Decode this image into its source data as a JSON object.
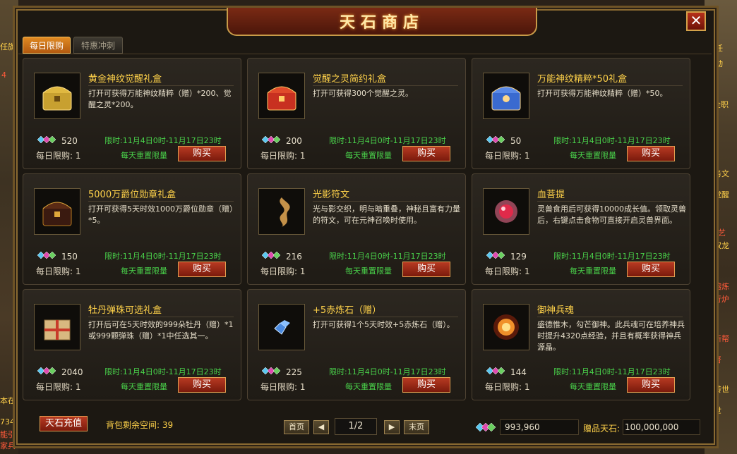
{
  "shop": {
    "title": "天石商店",
    "close_label": "✕",
    "tabs": [
      "每日限购",
      "特惠冲刺"
    ],
    "items": [
      {
        "name": "黄金神纹觉醒礼盒",
        "desc": "打开可获得万能神纹精粹（赠）*200、觉醒之灵*200。",
        "price": "520",
        "time": "限时:11月4日0时-11月17日23时",
        "daily": "每日限购: 1",
        "reset": "每天重置限量",
        "buy": "购买",
        "icon": "golden-chest-icon",
        "color": "#c8a030"
      },
      {
        "name": "觉醒之灵简约礼盒",
        "desc": "打开可获得300个觉醒之灵。",
        "price": "200",
        "time": "限时:11月4日0时-11月17日23时",
        "daily": "每日限购: 1",
        "reset": "每天重置限量",
        "buy": "购买",
        "icon": "red-chest-icon",
        "color": "#c83020"
      },
      {
        "name": "万能神纹精粹*50礼盒",
        "desc": "打开可获得万能神纹精粹（赠）*50。",
        "price": "50",
        "time": "限时:11月4日0时-11月17日23时",
        "daily": "每日限购: 1",
        "reset": "每天重置限量",
        "buy": "购买",
        "icon": "blue-chest-icon",
        "color": "#3a6ad0"
      },
      {
        "name": "5000万爵位勋章礼盒",
        "desc": "打开可获得5天时效1000万爵位勋章（赠）*5。",
        "price": "150",
        "time": "限时:11月4日0时-11月17日23时",
        "daily": "每日限购: 1",
        "reset": "每天重置限量",
        "buy": "购买",
        "icon": "medal-chest-icon",
        "color": "#b87a20"
      },
      {
        "name": "光影符文",
        "desc": "光与影交织，明与暗重叠，神秘且富有力量的符文，可在元神召唤时使用。",
        "price": "216",
        "time": "限时:11月4日0时-11月17日23时",
        "daily": "每日限购: 1",
        "reset": "每天重置限量",
        "buy": "购买",
        "icon": "rune-icon",
        "color": "#d8a050"
      },
      {
        "name": "血菩提",
        "desc": "灵兽食用后可获得10000成长值。领取灵兽后，右键点击食物可直接开启灵兽界面。",
        "price": "129",
        "time": "限时:11月4日0时-11月17日23时",
        "daily": "每日限购: 1",
        "reset": "每天重置限量",
        "buy": "购买",
        "icon": "blood-bodhi-icon",
        "color": "#e02a4a"
      },
      {
        "name": "牡丹弹珠可选礼盒",
        "desc": "打开后可在5天时效的999朵牡丹（赠）*1或999颗弹珠（赠）*1中任选其一。",
        "price": "2040",
        "time": "限时:11月4日0时-11月17日23时",
        "daily": "每日限购: 1",
        "reset": "每天重置限量",
        "buy": "购买",
        "icon": "gift-box-icon",
        "color": "#d8b880"
      },
      {
        "name": "+5赤炼石（赠）",
        "desc": "打开可获得1个5天时效+5赤炼石（赠）。",
        "price": "225",
        "time": "限时:11月4日0时-11月17日23时",
        "daily": "每日限购: 1",
        "reset": "每天重置限量",
        "buy": "购买",
        "icon": "blue-gem-icon",
        "color": "#4a8ae0"
      },
      {
        "name": "御神兵魂",
        "desc": "盛德惟木，勾芒御神。此兵魂可在培养神兵时提升4320点经验，并且有概率获得神兵源晶。",
        "price": "144",
        "time": "限时:11月4日0时-11月17日23时",
        "daily": "每日限购: 1",
        "reset": "每天重置限量",
        "buy": "购买",
        "icon": "fire-soul-icon",
        "color": "#f0902a"
      }
    ],
    "recharge_label": "天石充值",
    "bag_space": "背包剩余空间: 39",
    "pager": {
      "first": "首页",
      "page": "1/2",
      "last": "末页"
    },
    "balance": "993,960",
    "gift_label": "赠品天石:",
    "gift_value": "100,000,000"
  },
  "side": {
    "left": [
      "任旗",
      "4",
      "本在",
      "734",
      "能引",
      "家兵"
    ],
    "right": [
      "服任",
      "活动",
      "全职",
      "任务文",
      "首觉醒",
      "学艺",
      "给双龙",
      "料熔炼",
      "元行炉",
      "解新帮",
      "提督",
      "回转世",
      "转世"
    ]
  }
}
